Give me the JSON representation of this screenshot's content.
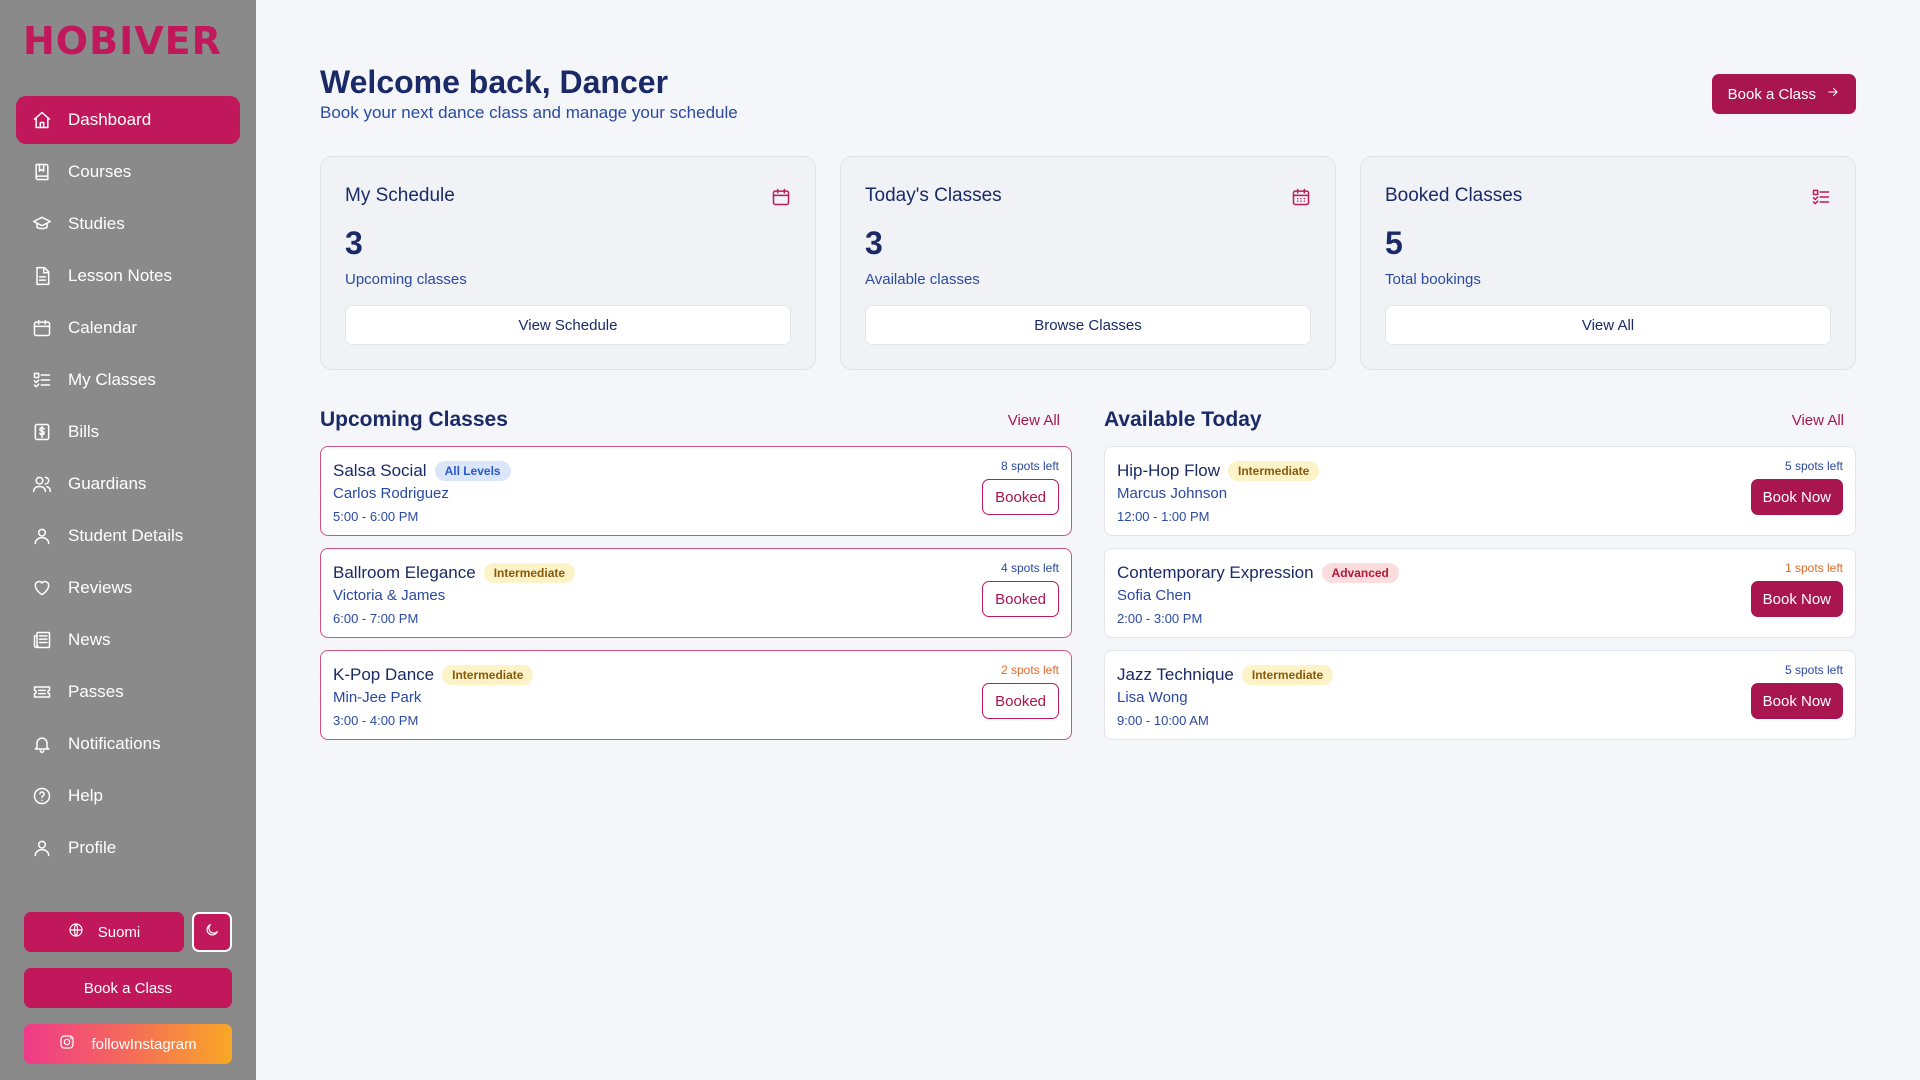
{
  "brand": {
    "logo": "HOBIVER",
    "accent": "#c0185a"
  },
  "sidebar": {
    "items": [
      {
        "label": "Dashboard",
        "icon": "home-icon",
        "active": true
      },
      {
        "label": "Courses",
        "icon": "book-icon"
      },
      {
        "label": "Studies",
        "icon": "graduation-cap-icon"
      },
      {
        "label": "Lesson Notes",
        "icon": "document-icon"
      },
      {
        "label": "Calendar",
        "icon": "calendar-icon"
      },
      {
        "label": "My Classes",
        "icon": "list-check-icon"
      },
      {
        "label": "Bills",
        "icon": "dollar-receipt-icon"
      },
      {
        "label": "Guardians",
        "icon": "users-icon"
      },
      {
        "label": "Student Details",
        "icon": "user-icon"
      },
      {
        "label": "Reviews",
        "icon": "heart-icon"
      },
      {
        "label": "News",
        "icon": "newspaper-icon"
      },
      {
        "label": "Passes",
        "icon": "ticket-icon"
      },
      {
        "label": "Notifications",
        "icon": "bell-icon"
      },
      {
        "label": "Help",
        "icon": "help-circle-icon"
      },
      {
        "label": "Profile",
        "icon": "user-icon"
      }
    ],
    "language_label": "Suomi",
    "book_label": "Book a Class",
    "instagram_label": "followInstagram"
  },
  "header": {
    "title": "Welcome back, Dancer",
    "subtitle": "Book your next dance class and manage your schedule",
    "book_button": "Book a Class"
  },
  "stats": [
    {
      "title": "My Schedule",
      "value": "3",
      "label": "Upcoming classes",
      "button": "View Schedule",
      "icon": "calendar-icon"
    },
    {
      "title": "Today's Classes",
      "value": "3",
      "label": "Available classes",
      "button": "Browse Classes",
      "icon": "calendar-days-icon"
    },
    {
      "title": "Booked Classes",
      "value": "5",
      "label": "Total bookings",
      "button": "View All",
      "icon": "list-check-icon"
    }
  ],
  "upcoming": {
    "title": "Upcoming Classes",
    "link": "View All",
    "classes": [
      {
        "name": "Salsa Social",
        "level": "All Levels",
        "teacher": "Carlos Rodriguez",
        "time": "5:00 - 6:00 PM",
        "spots": "8 spots left",
        "action": "Booked"
      },
      {
        "name": "Ballroom Elegance",
        "level": "Intermediate",
        "teacher": "Victoria & James",
        "time": "6:00 - 7:00 PM",
        "spots": "4 spots left",
        "action": "Booked"
      },
      {
        "name": "K-Pop Dance",
        "level": "Intermediate",
        "teacher": "Min-Jee Park",
        "time": "3:00 - 4:00 PM",
        "spots": "2 spots left",
        "action": "Booked"
      }
    ]
  },
  "available": {
    "title": "Available Today",
    "link": "View All",
    "classes": [
      {
        "name": "Hip-Hop Flow",
        "level": "Intermediate",
        "teacher": "Marcus Johnson",
        "time": "12:00 - 1:00 PM",
        "spots": "5 spots left",
        "action": "Book Now"
      },
      {
        "name": "Contemporary Expression",
        "level": "Advanced",
        "teacher": "Sofia Chen",
        "time": "2:00 - 3:00 PM",
        "spots": "1 spots left",
        "action": "Book Now"
      },
      {
        "name": "Jazz Technique",
        "level": "Intermediate",
        "teacher": "Lisa Wong",
        "time": "9:00 - 10:00 AM",
        "spots": "5 spots left",
        "action": "Book Now"
      }
    ]
  }
}
